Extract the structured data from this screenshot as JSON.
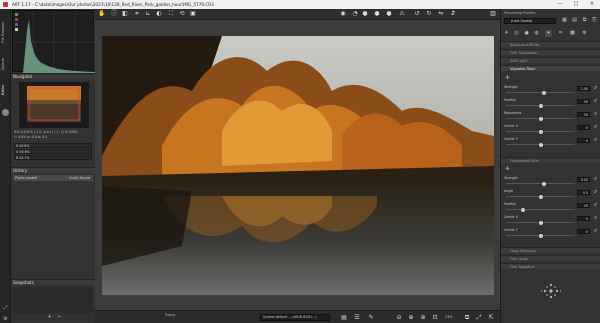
{
  "window": {
    "title": "ART 1.17 - C:\\data\\images\\Our photos\\2021\\10\\128_Red_River_Park_golden_hour\\IMG_5776.CR3",
    "minimize": "—",
    "maximize": "□",
    "close": "✕"
  },
  "left_tabs": [
    "File Browser",
    "Queue",
    "Editor"
  ],
  "left_panel": {
    "navigator_title": "Navigator",
    "nav_info_line1": "R:0 G:0 B:0  (-1.0 -0.0 L)  (-1; 1) 0  100%",
    "nav_info_line2": "L: 0.0%  a: 0.0  b: 0.0",
    "histogram_readouts": [
      {
        "label": "R",
        "value": "49.6%"
      },
      {
        "label": "G",
        "value": "53.6%"
      },
      {
        "label": "B",
        "value": "43.7%"
      }
    ],
    "history_title": "History",
    "history_items": [
      {
        "label": "Photo loaded",
        "detail": "Quick Saved"
      }
    ],
    "snapshots_title": "Snapshots",
    "snapshot_add": "+",
    "snapshot_remove": "−"
  },
  "status": {
    "zoom": "23%",
    "ready_label": "Ready",
    "profile_select": "System default ... (sRGB IEC61...)"
  },
  "right_panel": {
    "processing_profiles_label": "Processing Profiles",
    "profile_value": "(Last Saved)",
    "tools": [
      {
        "label": "Black-and-White",
        "active": false
      },
      {
        "label": "Film Simulation",
        "active": false
      },
      {
        "label": "Soft Light",
        "active": false
      },
      {
        "label": "Vignette Filter",
        "active": true
      }
    ],
    "vignette_params": [
      {
        "label": "Strength",
        "value": "1.00",
        "fraction": 0.55
      },
      {
        "label": "Feather",
        "value": "50",
        "fraction": 0.5
      },
      {
        "label": "Roundness",
        "value": "50",
        "fraction": 0.5
      },
      {
        "label": "Center X",
        "value": "0",
        "fraction": 0.5
      },
      {
        "label": "Center Y",
        "value": "0",
        "fraction": 0.5
      }
    ],
    "graduated_title": "Graduated Filter",
    "graduated_params": [
      {
        "label": "Strength",
        "value": "0.50",
        "fraction": 0.55
      },
      {
        "label": "Angle",
        "value": "0.0",
        "fraction": 0.5
      },
      {
        "label": "Feather",
        "value": "25",
        "fraction": 0.25
      },
      {
        "label": "Center X",
        "value": "0",
        "fraction": 0.5
      },
      {
        "label": "Center Y",
        "value": "0",
        "fraction": 0.5
      }
    ],
    "tools_bottom": [
      {
        "label": "Haze Removal"
      },
      {
        "label": "Film Grain"
      },
      {
        "label": "Film Negative"
      }
    ]
  },
  "colors": {
    "accent": "#4a89dc",
    "panel": "#323232",
    "canvas": "#3c3c3c"
  }
}
